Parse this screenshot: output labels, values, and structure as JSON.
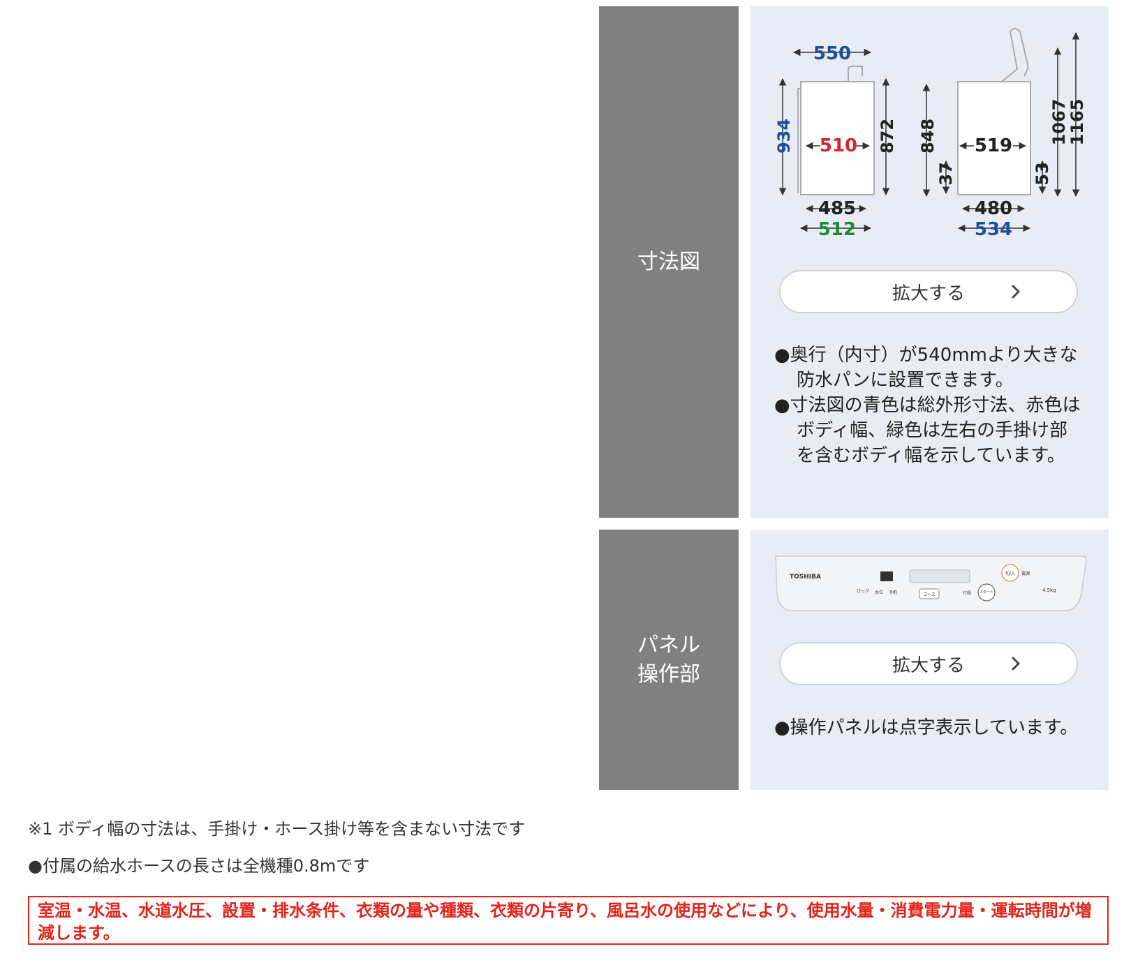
{
  "dimensions_section": {
    "label": "寸法図",
    "diagram": {
      "front": {
        "total_width": "550",
        "total_height": "934",
        "body_width": "510",
        "body_height": "872",
        "base_width": "485",
        "handle_width": "512"
      },
      "side": {
        "body_depth": "519",
        "body_height": "848",
        "foot_height_front": "37",
        "foot_height_back": "53",
        "lid_height": "1067",
        "lid_open_height": "1165",
        "base_depth": "480",
        "total_depth": "534"
      },
      "colors": {
        "total": "#1f4f9b",
        "body": "#d6262b",
        "handle": "#1f8a3a",
        "other": "#222222"
      }
    },
    "enlarge_button": "拡大する",
    "notes": [
      "●奥行（内寸）が540mmより大きな防水パンに設置できます。",
      "●寸法図の青色は総外形寸法、赤色はボディ幅、緑色は左右の手掛け部を含むボディ幅を示しています。"
    ]
  },
  "panel_section": {
    "label_lines": [
      "パネル",
      "操作部"
    ],
    "panel_image": {
      "brand": "TOSHIBA",
      "buttons": [
        "チャイルドロック",
        "水位",
        "予約",
        "コース",
        "行程",
        "スタート一時停止",
        "切/入"
      ],
      "button_labels": [
        "ロック",
        "水位",
        "予約",
        "コース",
        "行程",
        "スタート",
        "切/入"
      ],
      "power_label": "電源",
      "capacity": "4.5kg"
    },
    "enlarge_button": "拡大する",
    "notes": [
      "●操作パネルは点字表示しています。"
    ]
  },
  "footnotes": [
    "※1 ボディ幅の寸法は、手掛け・ホース掛け等を含まない寸法です",
    "●付属の給水ホースの長さは全機種0.8mです"
  ],
  "warning": "室温・水温、水道水圧、設置・排水条件、衣類の量や種類、衣類の片寄り、風呂水の使用などにより、使用水量・消費電力量・運転時間が増減します。"
}
